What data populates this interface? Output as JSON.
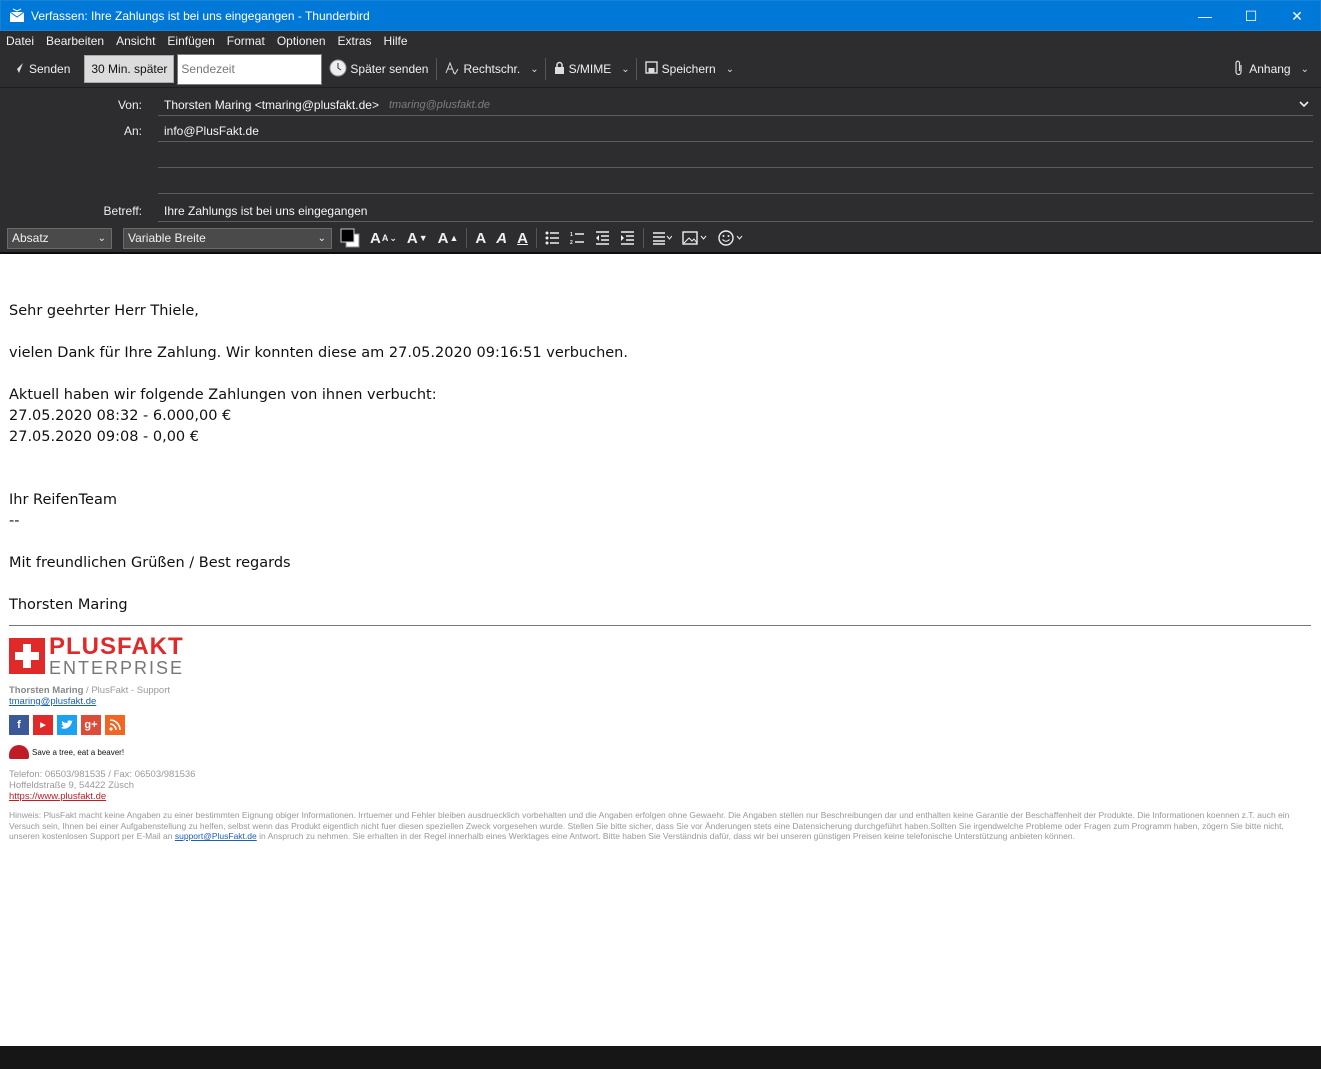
{
  "window": {
    "title": "Verfassen: Ihre Zahlungs ist bei uns eingegangen - Thunderbird",
    "minimize": "—",
    "maximize": "☐",
    "close": "✕"
  },
  "menu": [
    "Datei",
    "Bearbeiten",
    "Ansicht",
    "Einfügen",
    "Format",
    "Optionen",
    "Extras",
    "Hilfe"
  ],
  "toolbar": {
    "send": "Senden",
    "later_30": "30 Min. später",
    "sendtime_placeholder": "Sendezeit",
    "send_later": "Später senden",
    "spelling": "Rechtschr.",
    "smime": "S/MIME",
    "save": "Speichern",
    "attach": "Anhang"
  },
  "header": {
    "from_label": "Von:",
    "from_value": "Thorsten Maring <tmaring@plusfakt.de>",
    "from_hint": "tmaring@plusfakt.de",
    "to_label": "An:",
    "to_value": "info@PlusFakt.de",
    "subject_label": "Betreff:",
    "subject_value": "Ihre Zahlungs ist bei uns eingegangen"
  },
  "format": {
    "paragraph": "Absatz",
    "font": "Variable Breite"
  },
  "body": {
    "greeting": "Sehr geehrter Herr Thiele,",
    "thanks": "vielen Dank für Ihre Zahlung. Wir konnten diese am 27.05.2020 09:16:51 verbuchen.",
    "current": "Aktuell haben wir folgende Zahlungen von ihnen verbucht:",
    "pay1": "27.05.2020 08:32 - 6.000,00 €",
    "pay2": "27.05.2020 09:08 - 0,00 €",
    "team": "Ihr ReifenTeam",
    "dashes": "--",
    "regards": "Mit freundlichen Grüßen / Best regards",
    "name": "Thorsten Maring"
  },
  "signature": {
    "logo_top": "PLUSFAKT",
    "logo_bottom": "ENTERPRISE",
    "person": "Thorsten Maring",
    "role": " / PlusFakt - Support",
    "email": "tmaring@plusfakt.de",
    "beaver": "Save a tree, eat a beaver!",
    "phone": "Telefon: 06503/981535 / Fax: 06503/981536",
    "address": "Hoffeldstraße 9, 54422 Züsch",
    "website": "https://www.plusfakt.de",
    "disclaimer_a": "Hinweis: PlusFakt macht keine Angaben zu einer bestimmten Eignung obiger Informationen. Irrtuemer und Fehler bleiben ausdruecklich vorbehalten und die Angaben erfolgen ohne Gewaehr. Die Angaben stellen nur Beschreibungen dar und enthalten keine Garantie der Beschaffenheit der Produkte. Die Informationen koennen z.T. auch ein Versuch sein, Ihnen bei einer Aufgabenstellung zu helfen, selbst wenn das Produkt eigentlich nicht fuer diesen speziellen Zweck vorgesehen wurde. Stellen Sie bitte sicher, dass Sie vor Änderungen stets eine Datensicherung durchgeführt haben.Sollten Sie irgendwelche Probleme oder Fragen zum Programm haben, zögern Sie bitte nicht, unseren kostenlosen Support per E-Mail an ",
    "disclaimer_link": "support@PlusFakt.de",
    "disclaimer_b": " in Anspruch zu nehmen. Sie erhalten in der Regel innerhalb eines Werktages eine Antwort. Bitte haben Sie Verständnis dafür, dass wir bei unseren günstigen Preisen keine telefonische Unterstützung anbieten können."
  },
  "colors": {
    "titlebar": "#0078d7",
    "chrome": "#2d2d2f",
    "brand_red": "#e02a2a"
  }
}
